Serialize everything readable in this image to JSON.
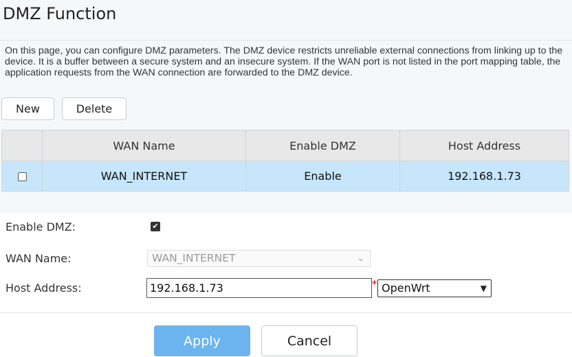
{
  "page": {
    "title": "DMZ Function",
    "description": "On this page, you can configure DMZ parameters. The DMZ device restricts unreliable external connections from linking up to the device. It is a buffer between a secure system and an insecure system. If the WAN port is not listed in the port mapping table, the application requests from the WAN connection are forwarded to the DMZ device."
  },
  "toolbar": {
    "new_label": "New",
    "delete_label": "Delete"
  },
  "table": {
    "headers": [
      "",
      "WAN Name",
      "Enable DMZ",
      "Host Address"
    ],
    "rows": [
      {
        "selected": false,
        "wan_name": "WAN_INTERNET",
        "enable_dmz": "Enable",
        "host_address": "192.168.1.73"
      }
    ]
  },
  "form": {
    "enable_dmz_label": "Enable DMZ:",
    "enable_dmz_checked": true,
    "wan_name_label": "WAN Name:",
    "wan_name_value": "WAN_INTERNET",
    "host_address_label": "Host Address:",
    "host_address_value": "192.168.1.73",
    "required_mark": "*",
    "host_select_value": "OpenWrt"
  },
  "actions": {
    "apply_label": "Apply",
    "cancel_label": "Cancel"
  },
  "colors": {
    "accent": "#6cb4f0",
    "selected_row": "#c7e6fb",
    "header_bg": "#e8e8e8",
    "required": "#dd0000"
  }
}
